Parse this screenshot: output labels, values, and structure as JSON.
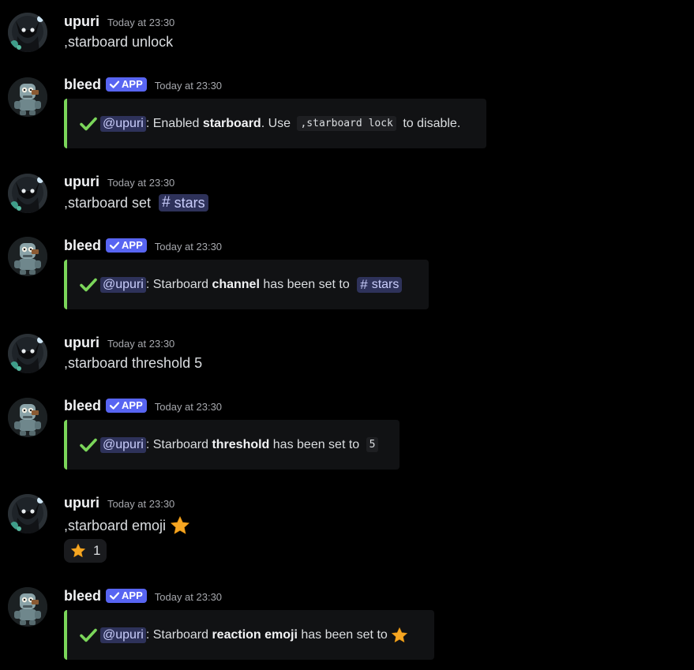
{
  "users": {
    "upuri": {
      "name": "upuri",
      "avatar_icon": "dark-cat-avatar-icon"
    },
    "bleed": {
      "name": "bleed",
      "badge": "APP",
      "avatar_icon": "robot-avatar-icon"
    }
  },
  "colors": {
    "success": "#7bd65a",
    "badge": "#5865f2",
    "mention_bg": "#2e325a",
    "star": "#f5a623"
  },
  "messages": [
    {
      "author": "upuri",
      "timestamp": "Today at 23:30",
      "text": ",starboard unlock"
    },
    {
      "author": "bleed",
      "badge": "APP",
      "timestamp": "Today at 23:30",
      "embed": {
        "mention": "@upuri",
        "sep": ": Enabled ",
        "bold": "starboard",
        "after": ". Use ",
        "code": ",starboard lock",
        "tail": " to disable."
      }
    },
    {
      "author": "upuri",
      "timestamp": "Today at 23:30",
      "text": ",starboard set ",
      "channel": "stars"
    },
    {
      "author": "bleed",
      "badge": "APP",
      "timestamp": "Today at 23:30",
      "embed": {
        "mention": "@upuri",
        "pre": ": Starboard ",
        "bold": "channel",
        "after": " has been set to ",
        "channel": "stars"
      }
    },
    {
      "author": "upuri",
      "timestamp": "Today at 23:30",
      "text": ",starboard threshold 5"
    },
    {
      "author": "bleed",
      "badge": "APP",
      "timestamp": "Today at 23:30",
      "embed": {
        "mention": "@upuri",
        "pre": ": Starboard ",
        "bold": "threshold",
        "after": " has been set to ",
        "code": "5"
      }
    },
    {
      "author": "upuri",
      "timestamp": "Today at 23:30",
      "text": ",starboard emoji ",
      "emoji": "star-icon",
      "reaction": {
        "emoji": "star-icon",
        "count": "1"
      }
    },
    {
      "author": "bleed",
      "badge": "APP",
      "timestamp": "Today at 23:30",
      "embed": {
        "mention": "@upuri",
        "pre": ": Starboard ",
        "bold": "reaction emoji",
        "after": " has been set to ",
        "emoji": "star-icon"
      }
    }
  ]
}
